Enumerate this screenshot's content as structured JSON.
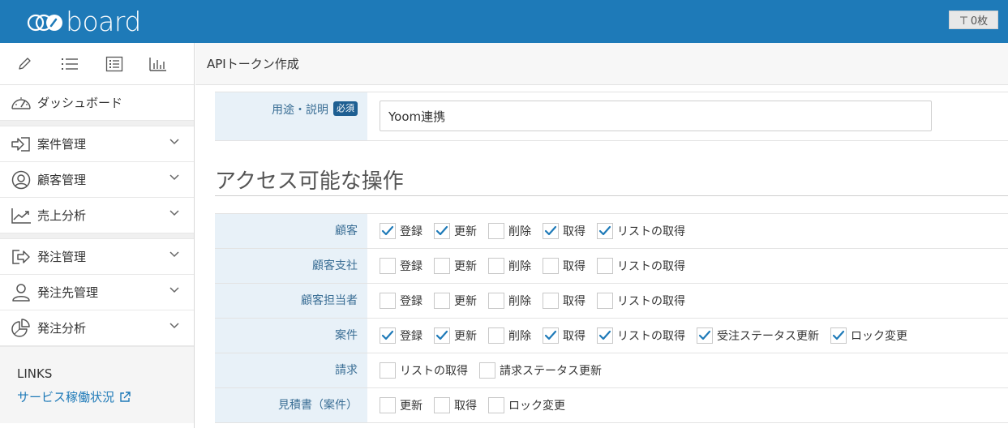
{
  "header": {
    "logo_text": "board",
    "pin_label": "0枚",
    "brand_color": "#1e7ab8"
  },
  "sidebar": {
    "toolbar": [
      {
        "icon": "pencil-icon"
      },
      {
        "icon": "list-icon"
      },
      {
        "icon": "document-list-icon"
      },
      {
        "icon": "bar-chart-icon"
      }
    ],
    "items": [
      {
        "label": "ダッシュボード",
        "icon": "speedometer-icon"
      },
      {
        "label": "案件管理",
        "icon": "enter-icon"
      },
      {
        "label": "顧客管理",
        "icon": "user-circle-icon"
      },
      {
        "label": "売上分析",
        "icon": "trend-chart-icon"
      },
      {
        "label": "発注管理",
        "icon": "share-out-icon"
      },
      {
        "label": "発注先管理",
        "icon": "person-icon"
      },
      {
        "label": "発注分析",
        "icon": "pie-chart-icon"
      }
    ],
    "links_title": "LINKS",
    "links": [
      {
        "label": "サービス稼働状況",
        "icon": "external-link-icon"
      }
    ]
  },
  "page": {
    "title": "APIトークン作成",
    "purpose_label": "用途・説明",
    "required_badge": "必須",
    "purpose_value": "Yoom連携",
    "section_title": "アクセス可能な操作"
  },
  "permissions": [
    {
      "label": "顧客",
      "options": [
        {
          "label": "登録",
          "checked": true
        },
        {
          "label": "更新",
          "checked": true
        },
        {
          "label": "削除",
          "checked": false
        },
        {
          "label": "取得",
          "checked": true
        },
        {
          "label": "リストの取得",
          "checked": true
        }
      ]
    },
    {
      "label": "顧客支社",
      "options": [
        {
          "label": "登録",
          "checked": false
        },
        {
          "label": "更新",
          "checked": false
        },
        {
          "label": "削除",
          "checked": false
        },
        {
          "label": "取得",
          "checked": false
        },
        {
          "label": "リストの取得",
          "checked": false
        }
      ]
    },
    {
      "label": "顧客担当者",
      "options": [
        {
          "label": "登録",
          "checked": false
        },
        {
          "label": "更新",
          "checked": false
        },
        {
          "label": "削除",
          "checked": false
        },
        {
          "label": "取得",
          "checked": false
        },
        {
          "label": "リストの取得",
          "checked": false
        }
      ]
    },
    {
      "label": "案件",
      "options": [
        {
          "label": "登録",
          "checked": true
        },
        {
          "label": "更新",
          "checked": true
        },
        {
          "label": "削除",
          "checked": false
        },
        {
          "label": "取得",
          "checked": true
        },
        {
          "label": "リストの取得",
          "checked": true
        },
        {
          "label": "受注ステータス更新",
          "checked": true
        },
        {
          "label": "ロック変更",
          "checked": true
        }
      ]
    },
    {
      "label": "請求",
      "options": [
        {
          "label": "リストの取得",
          "checked": false
        },
        {
          "label": "請求ステータス更新",
          "checked": false
        }
      ]
    },
    {
      "label": "見積書（案件）",
      "options": [
        {
          "label": "更新",
          "checked": false
        },
        {
          "label": "取得",
          "checked": false
        },
        {
          "label": "ロック変更",
          "checked": false
        }
      ]
    }
  ]
}
